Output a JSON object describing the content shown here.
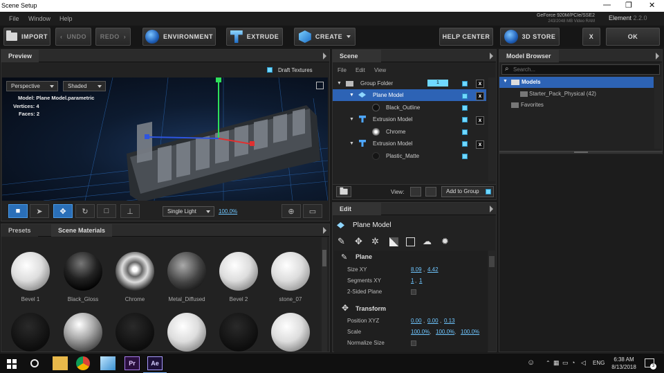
{
  "window": {
    "title": "Scene Setup",
    "controls": [
      "—",
      "❐",
      "✕"
    ]
  },
  "menu": [
    "File",
    "Window",
    "Help"
  ],
  "gpu": {
    "name": "GeForce 920M/PCIe/SSE2",
    "memory": "243/2048 MB Video RAM"
  },
  "app": {
    "name": "Element",
    "version": "2.2.0"
  },
  "toolbar": {
    "import": "IMPORT",
    "undo": "UNDO",
    "redo": "REDO",
    "environment": "ENVIRONMENT",
    "extrude": "EXTRUDE",
    "create": "CREATE",
    "help_center": "HELP CENTER",
    "store": "3D STORE",
    "close": "X",
    "ok": "OK"
  },
  "preview": {
    "tab": "Preview",
    "draft_textures": "Draft Textures",
    "draft_checked": true,
    "camera": "Perspective",
    "render_mode": "Shaded",
    "info": {
      "model_label": "Model:",
      "model_value": "Plane Model.parametric",
      "vertices_label": "Vertices:",
      "vertices_value": "4",
      "faces_label": "Faces:",
      "faces_value": "2"
    },
    "lighting": "Single Light",
    "zoom": "100.0%"
  },
  "scene": {
    "tab": "Scene",
    "menu": [
      "File",
      "Edit",
      "View"
    ],
    "items": [
      {
        "label": "Group Folder",
        "indent": 0,
        "type": "folder",
        "selected": false,
        "has_x": true
      },
      {
        "label": "Plane Model",
        "indent": 1,
        "type": "model",
        "selected": true,
        "has_x": true
      },
      {
        "label": "Black_Outline",
        "indent": 2,
        "type": "material",
        "selected": false,
        "has_x": false
      },
      {
        "label": "Extrusion Model",
        "indent": 1,
        "type": "model",
        "selected": false,
        "has_x": true
      },
      {
        "label": "Chrome",
        "indent": 2,
        "type": "material",
        "selected": false,
        "has_x": false
      },
      {
        "label": "Extrusion Model",
        "indent": 1,
        "type": "model",
        "selected": false,
        "has_x": true
      },
      {
        "label": "Plastic_Matte",
        "indent": 2,
        "type": "material",
        "selected": false,
        "has_x": false
      }
    ],
    "group_badge": "1",
    "view_label": "View:",
    "add_to_group": "Add to Group"
  },
  "materials": {
    "tabs": [
      "Presets",
      "Scene Materials"
    ],
    "active_tab": "Scene Materials",
    "row1": [
      "Bevel 1",
      "Black_Gloss",
      "Chrome",
      "Metal_Diffused",
      "Bevel 2",
      "stone_07"
    ]
  },
  "edit": {
    "tab": "Edit",
    "model": "Plane Model",
    "plane_section": "Plane",
    "size_label": "Size XY",
    "size_x": "8.09",
    "size_y": "4.42",
    "segments_label": "Segments XY",
    "seg_x": "1",
    "seg_y": "1",
    "two_sided_label": "2-Sided Plane",
    "transform_section": "Transform",
    "position_label": "Position XYZ",
    "pos_x": "0.00",
    "pos_y": "0.00",
    "pos_z": "0.13",
    "scale_label": "Scale",
    "scale_x": "100.0%",
    "scale_y": "100.0%",
    "scale_z": "100.0%",
    "normalize_label": "Normalize Size"
  },
  "browser": {
    "tab": "Model Browser",
    "search_placeholder": "Search...",
    "models": "Models",
    "starter_pack": "Starter_Pack_Physical (42)",
    "favorites": "Favorites"
  },
  "taskbar": {
    "lang": "ENG",
    "time": "6:38 AM",
    "date": "8/13/2018",
    "notifications": "3"
  }
}
